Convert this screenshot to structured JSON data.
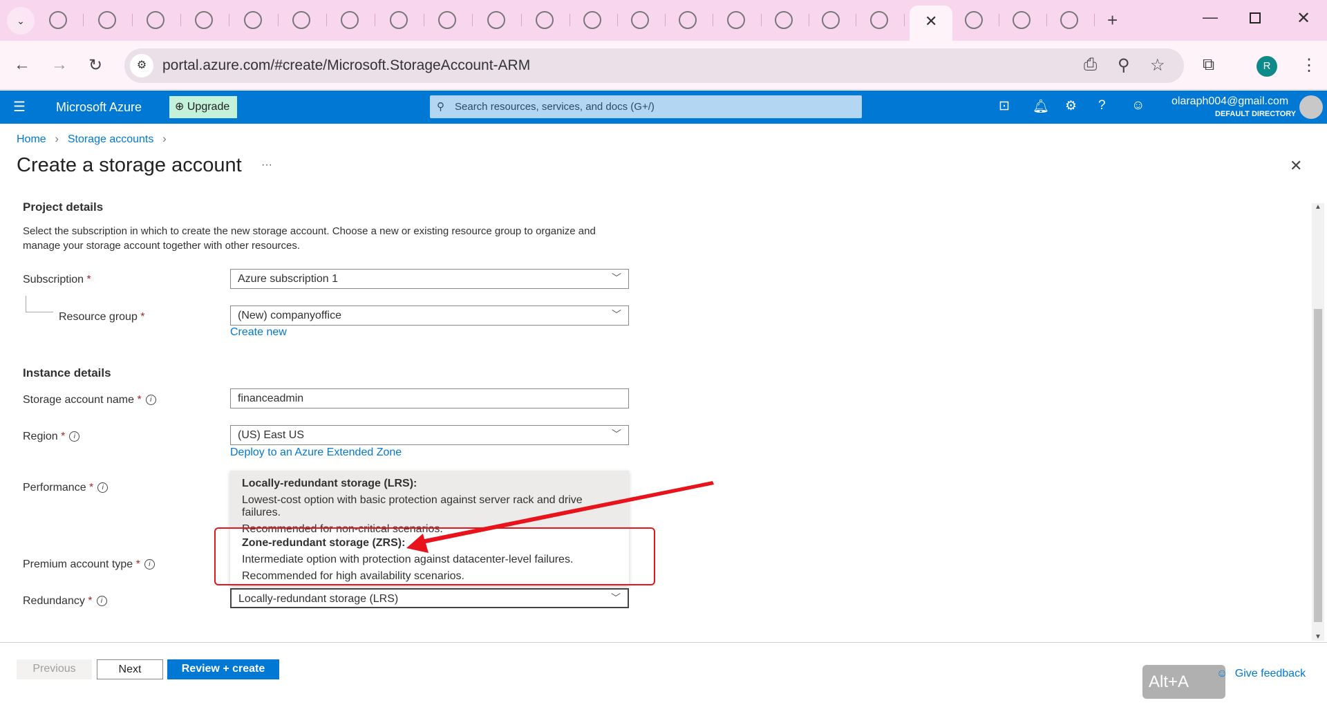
{
  "browser": {
    "url": "portal.azure.com/#create/Microsoft.StorageAccount-ARM",
    "profile_initial": "R",
    "tab_icons": [
      "gmail-icon",
      "tc-icon",
      "copilot-icon",
      "copilot-icon",
      "globe-icon",
      "copilot-icon",
      "github-icon",
      "openai-icon",
      "github-icon",
      "openai-icon",
      "chrome-icon",
      "microsoft-icon",
      "psi-icon",
      "copilot-icon",
      "openai-icon",
      "check-icon",
      "youtube-icon",
      "grammarly-icon",
      "active-tab",
      "google-icon",
      "openai-icon",
      "openai-icon"
    ]
  },
  "header": {
    "brand": "Microsoft Azure",
    "upgrade": "Upgrade",
    "search_placeholder": "Search resources, services, and docs (G+/)",
    "user_email": "olaraph004@gmail.com",
    "directory": "DEFAULT DIRECTORY"
  },
  "breadcrumb": [
    "Home",
    "Storage accounts"
  ],
  "page": {
    "title": "Create a storage account",
    "more": "···"
  },
  "project": {
    "heading": "Project details",
    "description": "Select the subscription in which to create the new storage account. Choose a new or existing resource group to organize and manage your storage account together with other resources.",
    "subscription_label": "Subscription",
    "subscription_value": "Azure subscription 1",
    "rg_label": "Resource group",
    "rg_value": "(New) companyoffice",
    "create_new": "Create new"
  },
  "instance": {
    "heading": "Instance details",
    "name_label": "Storage account name",
    "name_value": "financeadmin",
    "region_label": "Region",
    "region_value": "(US) East US",
    "deploy_link": "Deploy to an Azure Extended Zone",
    "performance_label": "Performance",
    "premium_label": "Premium account type",
    "redundancy_label": "Redundancy",
    "redundancy_value": "Locally-redundant storage (LRS)"
  },
  "redundancy_options": [
    {
      "title": "Locally-redundant storage (LRS):",
      "line1": "Lowest-cost option with basic protection against server rack and drive failures.",
      "line2": "Recommended for non-critical scenarios."
    },
    {
      "title": "Zone-redundant storage (ZRS):",
      "line1": "Intermediate option with protection against datacenter-level failures.",
      "line2": "Recommended for high availability scenarios."
    }
  ],
  "footer": {
    "previous": "Previous",
    "next": "Next",
    "review": "Review + create",
    "feedback": "Give feedback"
  },
  "overlay": {
    "shortcut": "Alt+A"
  },
  "colors": {
    "azure_blue": "#0078d4",
    "annotation_red": "#e8131b"
  }
}
